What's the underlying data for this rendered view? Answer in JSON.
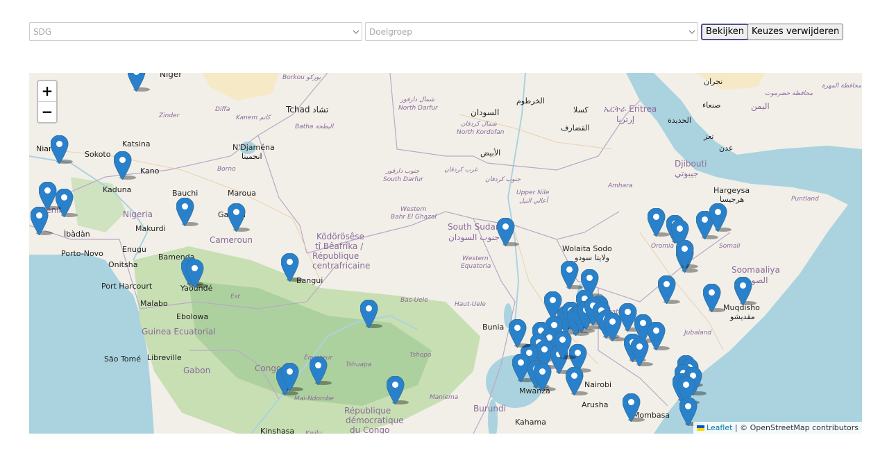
{
  "filters": {
    "sdg_placeholder": "SDG",
    "doelgroep_placeholder": "Doelgroep",
    "view_button": "Bekijken",
    "clear_button": "Keuzes verwijderen"
  },
  "map": {
    "zoom_in": "+",
    "zoom_out": "−",
    "attribution_leaflet": "Leaflet",
    "attribution_osm": "| © OpenStreetMap contributors",
    "place_labels": [
      "Niger",
      "Tchad تشاد",
      "Zinder",
      "Diffa",
      "Kanem كانم",
      "Batha البطحة",
      "Borkou بوركو",
      "Niamey",
      "Sokoto",
      "Katsina",
      "N'Djaména",
      "انجمينا",
      "Kano",
      "Borno",
      "Maroua",
      "Kaduna",
      "Bauchi",
      "Bénin",
      "Nigeria",
      "Garoua",
      "Makurdi",
      "Cameroun",
      "Enugu",
      "Porto-Novo",
      "Ìbàdàn",
      "Bamenda",
      "Onitsha",
      "Port Harcourt",
      "Yaoundé",
      "Malabo",
      "Ebolowa",
      "Guinea Ecuatorial",
      "Libreville",
      "São Tomé",
      "Gabon",
      "Congo",
      "Ködörösêse tî Bêafrîka / République centrafricaine",
      "Bangui",
      "Est",
      "Équateur",
      "Tshuapa",
      "Tshopo",
      "Bas-Uele",
      "Haut-Uele",
      "Maniema",
      "Mai-Ndombe",
      "Kinshasa",
      "République démocratique du Congo",
      "Kwilu",
      "شمال دارفور North Darfur",
      "السودان",
      "شمال كردفان North Kordofan",
      "الأبيض",
      "الخرطوم",
      "غرب كردفان",
      "جنوب دارفور South Darfur",
      "جنوب كردفان",
      "Western Bahr El Ghazal",
      "South Sudan جنوب السودان",
      "Upper Nile أعالي النيل",
      "Western Equatoria",
      "كسلا",
      "ኤርትራ Eritrea إرتريا",
      "القضارف",
      "Amhara",
      "Djibouti جيبوتي",
      "Hargeysa هرجيسا",
      "Puntland",
      "Oromia",
      "Wolaita Sodo ولايتا سودو",
      "Somali",
      "Soomaaliya الصومال",
      "Marsabit",
      "Muqdisho مقديشو",
      "Jubaland",
      "Bunia",
      "Kampala",
      "Burundi",
      "Kahama",
      "Mwanza",
      "Arusha",
      "Nairobi",
      "Mombasa",
      "صنعاء",
      "اليمن",
      "الحديدة",
      "تعز",
      "عدن",
      "نجران",
      "محافظة حضرموت",
      "محافظة المهرة"
    ],
    "markers": [
      {
        "lon": 6.1,
        "lat": 18.5
      },
      {
        "lon": 1.5,
        "lat": 13.0
      },
      {
        "lon": 5.3,
        "lat": 11.8
      },
      {
        "lon": 1.8,
        "lat": 9.0
      },
      {
        "lon": 0.3,
        "lat": 7.6
      },
      {
        "lon": 0.8,
        "lat": 9.5
      },
      {
        "lon": 9.0,
        "lat": 8.3
      },
      {
        "lon": 12.1,
        "lat": 7.9
      },
      {
        "lon": 9.3,
        "lat": 3.8
      },
      {
        "lon": 9.6,
        "lat": 3.6
      },
      {
        "lon": 15.3,
        "lat": 4.1
      },
      {
        "lon": 20.0,
        "lat": 0.6
      },
      {
        "lon": 28.2,
        "lat": 6.8
      },
      {
        "lon": 37.2,
        "lat": 7.5
      },
      {
        "lon": 38.3,
        "lat": 7.0
      },
      {
        "lon": 38.6,
        "lat": 6.6
      },
      {
        "lon": 38.9,
        "lat": 4.8
      },
      {
        "lon": 38.9,
        "lat": 5.1
      },
      {
        "lon": 40.1,
        "lat": 7.3
      },
      {
        "lon": 40.9,
        "lat": 7.9
      },
      {
        "lon": 37.8,
        "lat": 2.4
      },
      {
        "lon": 40.5,
        "lat": 1.8
      },
      {
        "lon": 42.4,
        "lat": 2.3
      },
      {
        "lon": 32.0,
        "lat": 3.5
      },
      {
        "lon": 33.2,
        "lat": 2.9
      },
      {
        "lon": 32.9,
        "lat": 1.3
      },
      {
        "lon": 33.8,
        "lat": 0.9
      },
      {
        "lon": 31.0,
        "lat": 1.2
      },
      {
        "lon": 31.8,
        "lat": 0.1
      },
      {
        "lon": 32.1,
        "lat": 0.4
      },
      {
        "lon": 32.4,
        "lat": 0.0
      },
      {
        "lon": 32.7,
        "lat": 0.2
      },
      {
        "lon": 33.0,
        "lat": 0.5
      },
      {
        "lon": 33.4,
        "lat": 0.8
      },
      {
        "lon": 33.9,
        "lat": 0.4
      },
      {
        "lon": 34.2,
        "lat": -0.2
      },
      {
        "lon": 34.6,
        "lat": -0.4
      },
      {
        "lon": 35.5,
        "lat": 0.3
      },
      {
        "lon": 36.4,
        "lat": -0.5
      },
      {
        "lon": 37.2,
        "lat": -1.1
      },
      {
        "lon": 35.8,
        "lat": -2.0
      },
      {
        "lon": 36.2,
        "lat": -2.3
      },
      {
        "lon": 31.1,
        "lat": -0.7
      },
      {
        "lon": 30.3,
        "lat": -1.1
      },
      {
        "lon": 30.8,
        "lat": -1.6
      },
      {
        "lon": 30.2,
        "lat": -2.0
      },
      {
        "lon": 30.5,
        "lat": -2.5
      },
      {
        "lon": 29.6,
        "lat": -2.8
      },
      {
        "lon": 29.1,
        "lat": -3.5
      },
      {
        "lon": 30.0,
        "lat": -4.0
      },
      {
        "lon": 30.4,
        "lat": -4.2
      },
      {
        "lon": 31.4,
        "lat": -2.9
      },
      {
        "lon": 32.5,
        "lat": -2.8
      },
      {
        "lon": 32.3,
        "lat": -4.5
      },
      {
        "lon": 31.6,
        "lat": -1.8
      },
      {
        "lon": 39.0,
        "lat": -3.6
      },
      {
        "lon": 39.2,
        "lat": -3.9
      },
      {
        "lon": 38.8,
        "lat": -4.3
      },
      {
        "lon": 39.4,
        "lat": -4.5
      },
      {
        "lon": 38.7,
        "lat": -5.0
      },
      {
        "lon": 39.0,
        "lat": -5.2
      },
      {
        "lon": 39.1,
        "lat": -6.8
      },
      {
        "lon": 35.7,
        "lat": -6.5
      },
      {
        "lon": 21.6,
        "lat": -5.2
      },
      {
        "lon": 17.0,
        "lat": -3.7
      },
      {
        "lon": 15.0,
        "lat": -4.5
      },
      {
        "lon": 15.3,
        "lat": -4.2
      },
      {
        "lon": 28.9,
        "lat": -0.9
      }
    ]
  },
  "colors": {
    "water": "#aad3df",
    "land": "#f2efe9",
    "forest": "#add19e",
    "desert": "#f5e9c6",
    "marker": "#2a81cb",
    "marker_dark": "#3274a3"
  }
}
